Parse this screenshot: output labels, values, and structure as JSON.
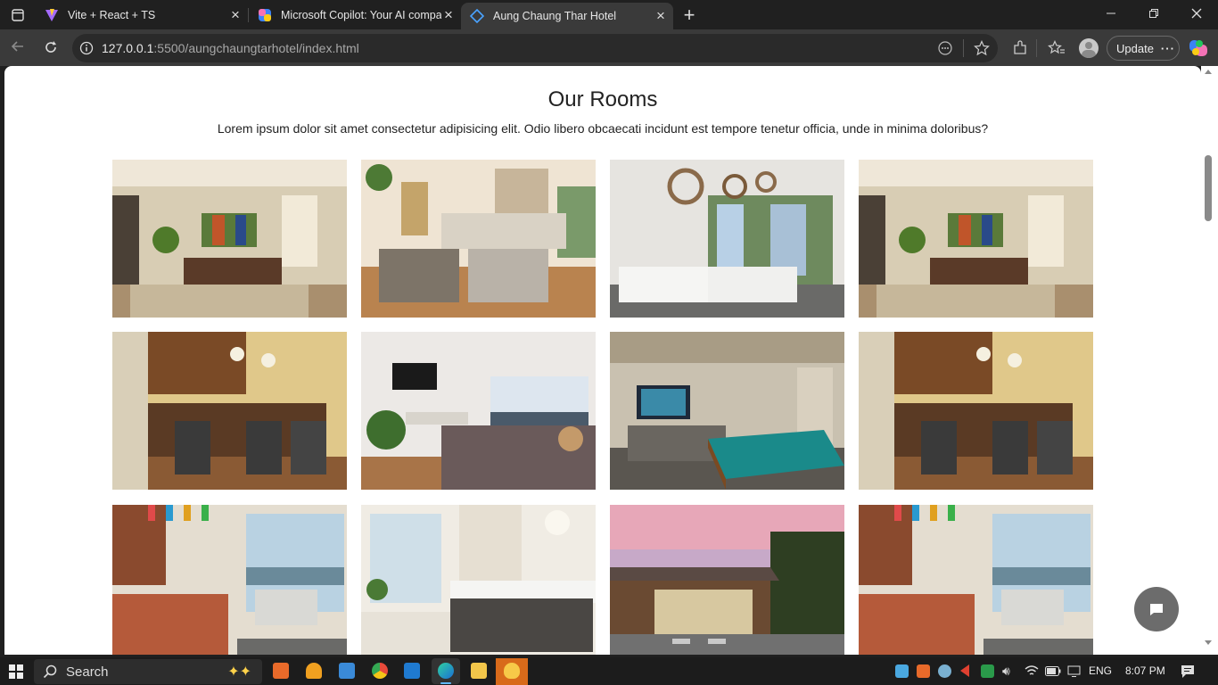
{
  "browser": {
    "tabs": [
      {
        "title": "Vite + React + TS",
        "icon": "vite-icon"
      },
      {
        "title": "Microsoft Copilot: Your AI compa",
        "icon": "copilot-icon"
      },
      {
        "title": "Aung Chaung Thar Hotel",
        "icon": "code-icon"
      }
    ],
    "url_host": "127.0.0.1",
    "url_rest": ":5500/aungchaungtarhotel/index.html",
    "update_label": "Update"
  },
  "page": {
    "title": "Our Rooms",
    "description": "Lorem ipsum dolor sit amet consectetur adipisicing elit. Odio libero obcaecati incidunt est tempore tenetur officia, unde in minima doloribus?",
    "rooms": [
      {
        "name": "living-room-photo"
      },
      {
        "name": "lounge-photo"
      },
      {
        "name": "sunroom-photo"
      },
      {
        "name": "living-room-photo"
      },
      {
        "name": "kitchen-bar-photo"
      },
      {
        "name": "bedroom-photo"
      },
      {
        "name": "game-room-photo"
      },
      {
        "name": "kitchen-bar-photo"
      },
      {
        "name": "dining-kitchen-photo"
      },
      {
        "name": "bathroom-photo"
      },
      {
        "name": "house-exterior-photo"
      },
      {
        "name": "dining-kitchen-photo"
      }
    ]
  },
  "taskbar": {
    "search_label": "Search",
    "lang": "ENG",
    "time": "8:07 PM"
  },
  "colors": {
    "accent": "#0078d4",
    "chat_button": "#6c6c6c"
  }
}
